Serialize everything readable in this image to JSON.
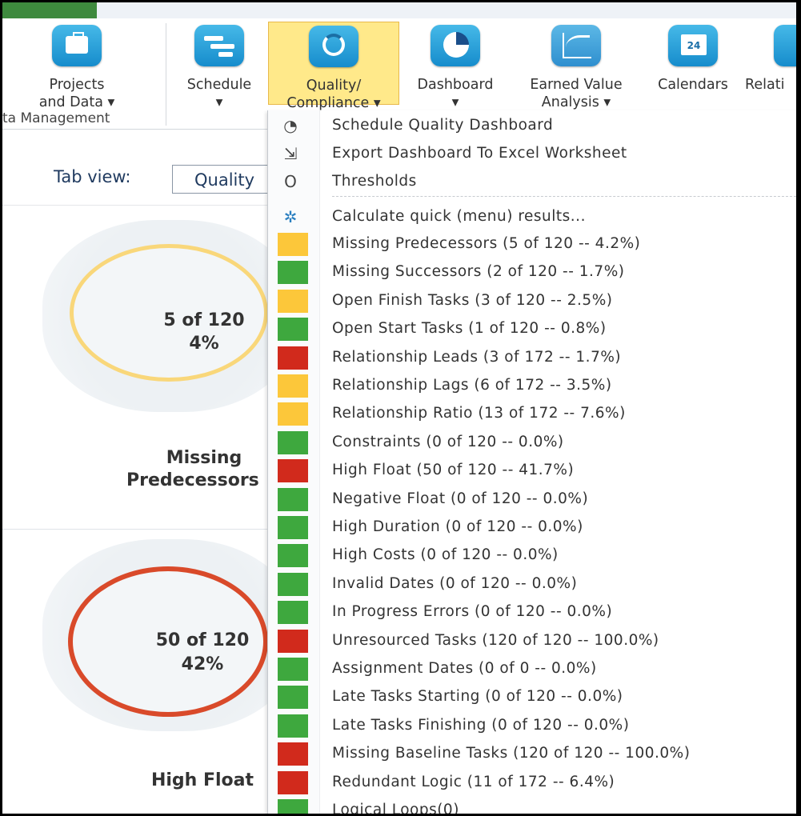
{
  "ribbon": {
    "buttons": [
      {
        "id": "projects",
        "line1": "Projects",
        "line2": "and Data ▾"
      },
      {
        "id": "schedule",
        "line1": "Schedule",
        "line2": "▾"
      },
      {
        "id": "quality",
        "line1": "Quality/",
        "line2": "Compliance ▾"
      },
      {
        "id": "dashboard",
        "line1": "Dashboard",
        "line2": "▾"
      },
      {
        "id": "earned",
        "line1": "Earned Value",
        "line2": "Analysis ▾"
      },
      {
        "id": "calendars",
        "line1": "Calendars",
        "line2": ""
      },
      {
        "id": "relati",
        "line1": "Relati",
        "line2": ""
      }
    ],
    "group_label": "ta Management",
    "calendar_icon_text": "24"
  },
  "tab_view": {
    "label": "Tab view:",
    "value": "Quality"
  },
  "cards": [
    {
      "id": "missing-predecessors",
      "value": "5 of 120",
      "percent": "4%",
      "title_line1": "Missing",
      "title_line2": "Predecessors",
      "ring_color": "#f9d77a"
    },
    {
      "id": "high-float",
      "value": "50 of 120",
      "percent": "42%",
      "title_line1": "High Float",
      "title_line2": "",
      "ring_color": "#d94a2a"
    }
  ],
  "menu": {
    "header_items": [
      {
        "label": "Schedule Quality Dashboard",
        "icon": "gauge-icon",
        "glyph": "◔"
      },
      {
        "label": "Export Dashboard To Excel Worksheet",
        "icon": "export-icon",
        "glyph": "⇲"
      },
      {
        "label": "Thresholds",
        "icon": "circle-icon",
        "glyph": "O"
      },
      {
        "label": "Calculate quick (menu) results...",
        "icon": "gear-icon",
        "glyph": "✲"
      }
    ],
    "items": [
      {
        "label": "Missing Predecessors (5 of 120 -- 4.2%)",
        "status": "yellow"
      },
      {
        "label": "Missing Successors (2 of 120 -- 1.7%)",
        "status": "green"
      },
      {
        "label": "Open Finish Tasks (3 of 120 -- 2.5%)",
        "status": "yellow"
      },
      {
        "label": "Open Start Tasks (1 of 120 -- 0.8%)",
        "status": "green"
      },
      {
        "label": "Relationship Leads (3 of 172 -- 1.7%)",
        "status": "red"
      },
      {
        "label": "Relationship Lags (6 of 172 -- 3.5%)",
        "status": "yellow"
      },
      {
        "label": "Relationship Ratio (13 of 172 -- 7.6%)",
        "status": "yellow"
      },
      {
        "label": "Constraints (0 of 120 -- 0.0%)",
        "status": "green"
      },
      {
        "label": "High Float (50 of 120 -- 41.7%)",
        "status": "red"
      },
      {
        "label": "Negative Float (0 of 120 -- 0.0%)",
        "status": "green"
      },
      {
        "label": "High Duration (0 of 120 -- 0.0%)",
        "status": "green"
      },
      {
        "label": "High Costs (0 of 120 -- 0.0%)",
        "status": "green"
      },
      {
        "label": "Invalid Dates (0 of 120 -- 0.0%)",
        "status": "green"
      },
      {
        "label": "In Progress Errors (0 of 120 -- 0.0%)",
        "status": "green"
      },
      {
        "label": "Unresourced Tasks (120 of 120 -- 100.0%)",
        "status": "red"
      },
      {
        "label": "Assignment Dates (0 of 0 -- 0.0%)",
        "status": "green"
      },
      {
        "label": "Late Tasks Starting (0 of 120 -- 0.0%)",
        "status": "green"
      },
      {
        "label": "Late Tasks Finishing (0 of 120 -- 0.0%)",
        "status": "green"
      },
      {
        "label": "Missing Baseline Tasks (120 of 120 -- 100.0%)",
        "status": "red"
      },
      {
        "label": "Redundant Logic (11 of 172 -- 6.4%)",
        "status": "red"
      },
      {
        "label": "Logical Loops(0)",
        "status": "green"
      }
    ]
  },
  "status_colors": {
    "green": "#3ea83e",
    "yellow": "#fcc73a",
    "red": "#d12a1c"
  }
}
